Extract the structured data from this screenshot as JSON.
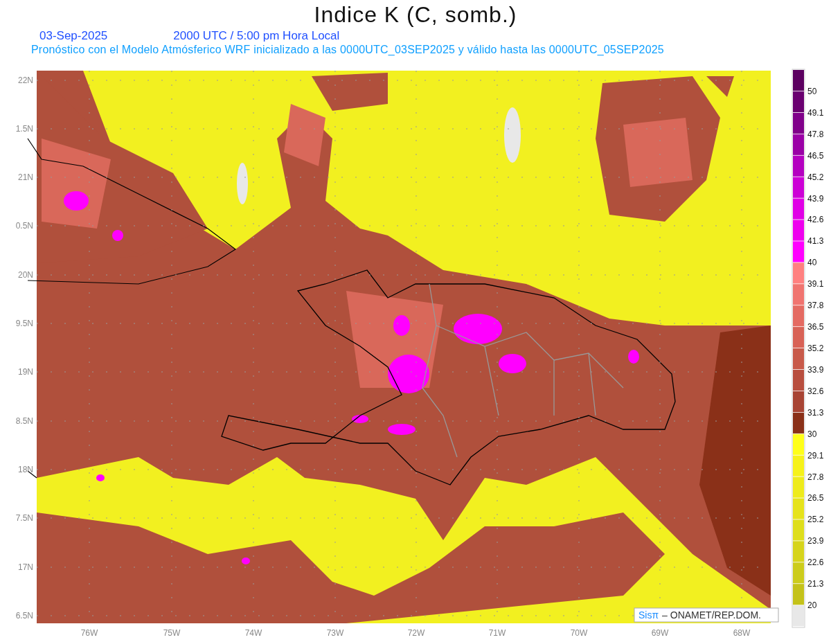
{
  "title": "Indice K (C, somb.)",
  "date": "03-Sep-2025",
  "time": "2000 UTC / 5:00 pm Hora Local",
  "subtitle": "Pronóstico con el Modelo Atmósferico WRF inicializado a las 0000UTC_03SEP2025 y válido hasta las  0000UTC_05SEP2025",
  "map": {
    "y_labels": [
      "22N",
      "1.5N",
      "21N",
      "0.5N",
      "20N",
      "9.5N",
      "19N",
      "8.5N",
      "18N",
      "7.5N",
      "17N",
      "6.5N"
    ],
    "x_labels": [
      "76W",
      "75W",
      "74W",
      "73W",
      "72W",
      "71W",
      "70W",
      "69W",
      "68W"
    ]
  },
  "colorbar": [
    {
      "color": "#5c0060",
      "label": "50"
    },
    {
      "color": "#6a0070",
      "label": "49.1"
    },
    {
      "color": "#80008a",
      "label": "47.8"
    },
    {
      "color": "#9a00a6",
      "label": "46.5"
    },
    {
      "color": "#b400c0",
      "label": "45.2"
    },
    {
      "color": "#cc00d6",
      "label": "43.9"
    },
    {
      "color": "#e000e6",
      "label": "42.6"
    },
    {
      "color": "#ee00ee",
      "label": "41.3"
    },
    {
      "color": "#ff00ff",
      "label": "40"
    },
    {
      "color": "#ff8080",
      "label": "39.1"
    },
    {
      "color": "#f07470",
      "label": "37.8"
    },
    {
      "color": "#e46a62",
      "label": "36.5"
    },
    {
      "color": "#d86256",
      "label": "35.2"
    },
    {
      "color": "#c85a4a",
      "label": "33.9"
    },
    {
      "color": "#b84e3e",
      "label": "32.6"
    },
    {
      "color": "#a84434",
      "label": "31.3"
    },
    {
      "color": "#8a3018",
      "label": "30"
    },
    {
      "color": "#ffff1a",
      "label": "29.1"
    },
    {
      "color": "#f6f21a",
      "label": "27.8"
    },
    {
      "color": "#eeeb1c",
      "label": "26.5"
    },
    {
      "color": "#e6e31c",
      "label": "25.2"
    },
    {
      "color": "#dede1c",
      "label": "23.9"
    },
    {
      "color": "#d6d41c",
      "label": "22.6"
    },
    {
      "color": "#cccc1c",
      "label": "21.3"
    },
    {
      "color": "#c4c21a",
      "label": "20"
    },
    {
      "color": "#e8e8e8"
    }
  ],
  "credit": {
    "brand": "Sisπ",
    "text": "– ONAMET/REP.DOM."
  }
}
